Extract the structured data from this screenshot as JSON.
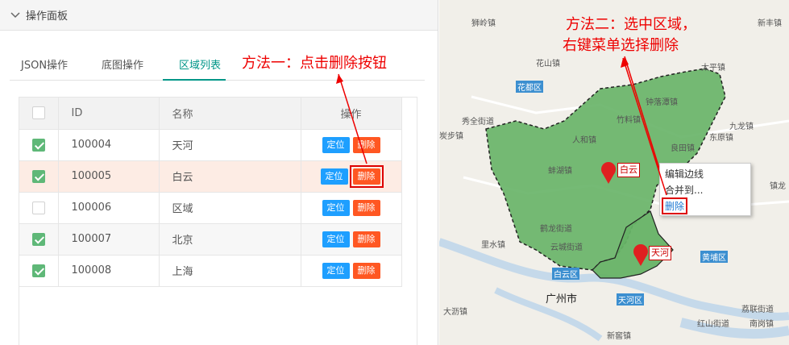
{
  "panel": {
    "title": "操作面板",
    "tabs": [
      "JSON操作",
      "底图操作",
      "区域列表"
    ],
    "active_tab": 2,
    "table": {
      "headers": [
        "ID",
        "名称",
        "操作"
      ],
      "locate_label": "定位",
      "delete_label": "删除",
      "rows": [
        {
          "id": "100004",
          "name": "天河",
          "checked": true
        },
        {
          "id": "100005",
          "name": "白云",
          "checked": true
        },
        {
          "id": "100006",
          "name": "区域",
          "checked": false
        },
        {
          "id": "100007",
          "name": "北京",
          "checked": true
        },
        {
          "id": "100008",
          "name": "上海",
          "checked": true
        }
      ]
    }
  },
  "annotations": {
    "method1": "方法一：点击删除按钮",
    "method2_line1": "方法二：选中区域，",
    "method2_line2": "右键菜单选择删除"
  },
  "context_menu": {
    "items": [
      "编辑边线",
      "合并到...",
      "删除"
    ]
  },
  "map": {
    "markers": [
      "白云",
      "天河"
    ],
    "city": "广州市",
    "places": [
      "狮岭镇",
      "新丰镇",
      "花山镇",
      "太平镇",
      "钟落潭镇",
      "竹料镇",
      "九龙镇",
      "秀全街道",
      "人和镇",
      "东原镇",
      "炭步镇",
      "良田镇",
      "蚌湖镇",
      "镇龙",
      "里水镇",
      "鹤龙街道",
      "云城街道",
      "大沥镇",
      "荔联街道",
      "红山街道",
      "南岗镇",
      "新窖镇"
    ],
    "district_badges": [
      "花都区",
      "黄埔区",
      "天河区",
      "白云区"
    ]
  }
}
